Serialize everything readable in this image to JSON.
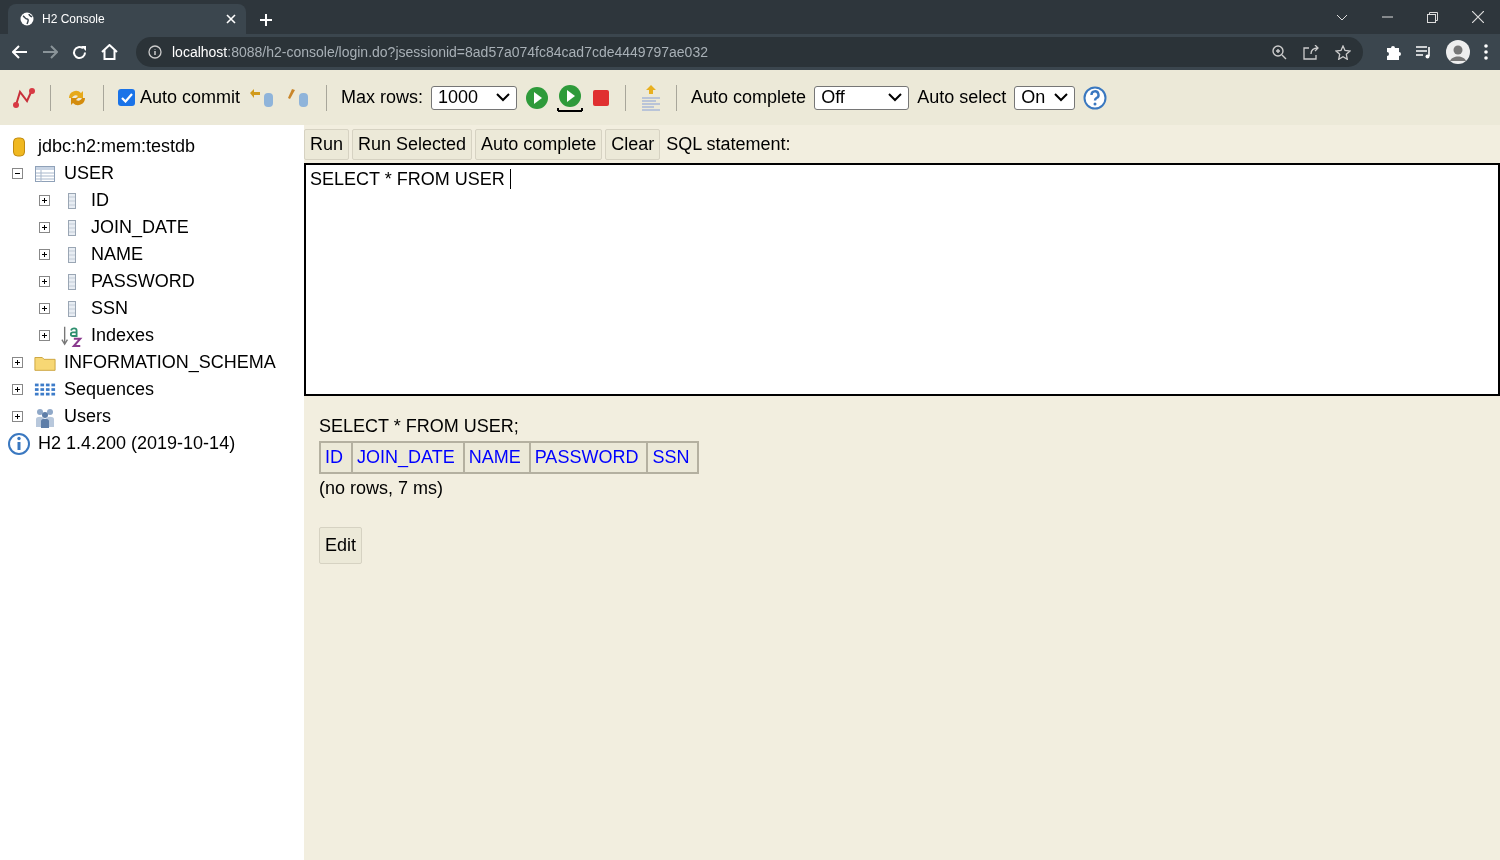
{
  "browser": {
    "tab_title": "H2 Console",
    "url_host": "localhost",
    "url_path": ":8088/h2-console/login.do?jsessionid=8ad57a074fc84cad7cde4449797ae032"
  },
  "toolbar": {
    "auto_commit": {
      "label": "Auto commit",
      "checked": true
    },
    "max_rows_label": "Max rows:",
    "max_rows": "1000",
    "auto_complete_label": "Auto complete",
    "auto_complete": "Off",
    "auto_select_label": "Auto select",
    "auto_select": "On"
  },
  "tree": {
    "connection": "jdbc:h2:mem:testdb",
    "items": [
      {
        "kind": "table",
        "label": "USER",
        "expanded": true,
        "children": [
          {
            "kind": "column",
            "label": "ID",
            "expanded": false
          },
          {
            "kind": "column",
            "label": "JOIN_DATE",
            "expanded": false
          },
          {
            "kind": "column",
            "label": "NAME",
            "expanded": false
          },
          {
            "kind": "column",
            "label": "PASSWORD",
            "expanded": false
          },
          {
            "kind": "column",
            "label": "SSN",
            "expanded": false
          },
          {
            "kind": "index",
            "label": "Indexes",
            "expanded": false
          }
        ]
      },
      {
        "kind": "schema",
        "label": "INFORMATION_SCHEMA",
        "expanded": false
      },
      {
        "kind": "sequence",
        "label": "Sequences",
        "expanded": false
      },
      {
        "kind": "users",
        "label": "Users",
        "expanded": false
      }
    ],
    "version": "H2 1.4.200 (2019-10-14)"
  },
  "editor": {
    "buttons": [
      "Run",
      "Run Selected",
      "Auto complete",
      "Clear"
    ],
    "label": "SQL statement:",
    "value": "SELECT * FROM USER"
  },
  "result": {
    "query": "SELECT * FROM USER;",
    "columns": [
      "ID",
      "JOIN_DATE",
      "NAME",
      "PASSWORD",
      "SSN"
    ],
    "status": "(no rows, 7 ms)",
    "edit_button": "Edit"
  }
}
